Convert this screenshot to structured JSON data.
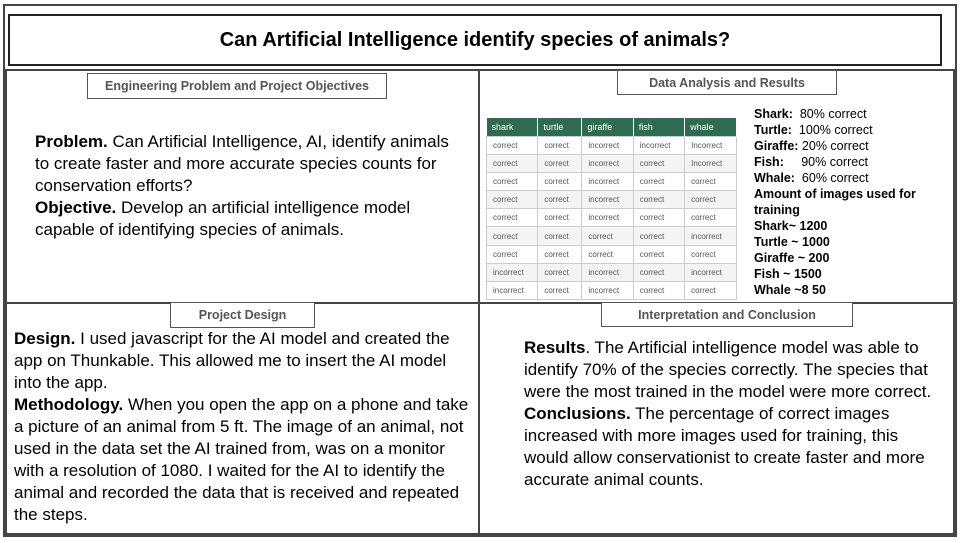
{
  "title": "Can Artificial Intelligence identify species of animals?",
  "sections": {
    "problem": {
      "label": "Engineering Problem and Project Objectives",
      "problem_head": "Problem.",
      "problem_text": " Can Artificial Intelligence, AI, identify animals to create faster and more accurate species counts for conservation efforts?",
      "objective_head": "Objective.",
      "objective_text": " Develop an artificial intelligence model capable of identifying species of animals."
    },
    "data": {
      "label": "Data Analysis and Results",
      "table": {
        "headers": [
          "shark",
          "turtle",
          "giraffe",
          "fish",
          "whale"
        ],
        "rows": [
          [
            "correct",
            "correct",
            "incorrect",
            "incorrect",
            "Incorrect"
          ],
          [
            "correct",
            "correct",
            "incorrect",
            "correct",
            "Incorrect"
          ],
          [
            "correct",
            "correct",
            "incorrect",
            "correct",
            "correct"
          ],
          [
            "correct",
            "correct",
            "incorrect",
            "correct",
            "correct"
          ],
          [
            "correct",
            "correct",
            "incorrect",
            "correct",
            "correct"
          ],
          [
            "correct",
            "correct",
            "correct",
            "correct",
            "incorrect"
          ],
          [
            "correct",
            "correct",
            "correct",
            "correct",
            "correct"
          ],
          [
            "incorrect",
            "correct",
            "incorrect",
            "correct",
            "incorrect"
          ],
          [
            "incorrect",
            "correct",
            "incorrect",
            "correct",
            "correct"
          ]
        ]
      },
      "accuracy": [
        {
          "name": "Shark:",
          "value": "  80% correct"
        },
        {
          "name": "Turtle:",
          "value": "  100% correct"
        },
        {
          "name": "Giraffe:",
          "value": " 20% correct"
        },
        {
          "name": "Fish:",
          "value": "     90% correct"
        },
        {
          "name": "Whale:",
          "value": "  60% correct"
        }
      ],
      "training_head": "Amount of images used for training",
      "training": [
        "Shark~ 1200",
        "Turtle ~ 1000",
        "Giraffe ~ 200",
        "Fish ~ 1500",
        "Whale ~8 50"
      ]
    },
    "design": {
      "label": "Project Design",
      "design_head": "Design.",
      "design_text": " I used javascript for the AI model and created the app on Thunkable. This allowed me to insert the AI model into the app.",
      "method_head": "Methodology.",
      "method_text": " When you open the app on a phone and take a picture of an animal from 5 ft. The image of an animal, not used in the data set the AI trained from, was on a monitor with a resolution of 1080. I waited for the AI to identify the animal and recorded the data that is received and repeated the steps."
    },
    "conclusion": {
      "label": "Interpretation and Conclusion",
      "results_head": "Results",
      "results_text": ". The Artificial intelligence model was able to identify 70% of the species correctly. The species that were the most trained in the model were more correct.",
      "concl_head": "Conclusions.",
      "concl_text": " The percentage of correct images increased with more images used for training, this would allow conservationist to create faster and more accurate animal counts."
    }
  },
  "colors": {
    "table_header": "#2f6b52",
    "border": "#444444"
  }
}
